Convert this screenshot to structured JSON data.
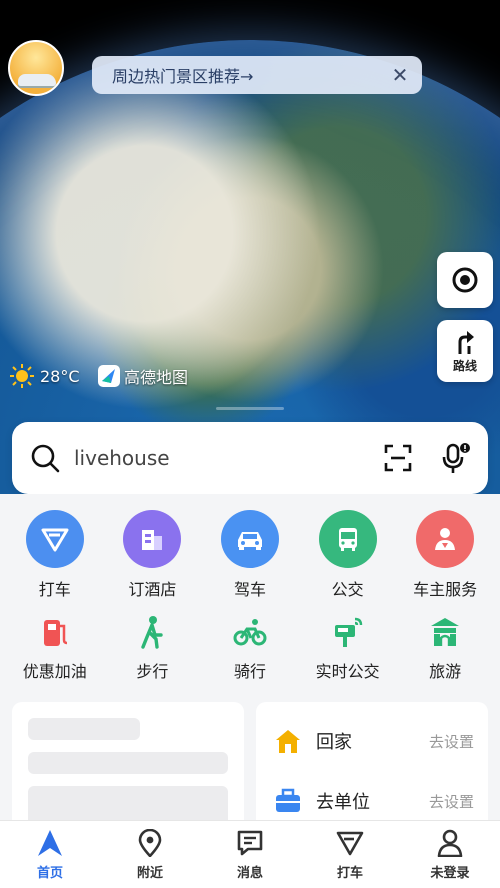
{
  "banner": {
    "text": "周边热门景区推荐→"
  },
  "map": {
    "route_label": "路线",
    "weather": "28°C",
    "brand": "高德地图"
  },
  "search": {
    "value": "livehouse"
  },
  "primary_services": [
    {
      "label": "打车",
      "color": "#4c8ff0",
      "icon": "taxi-icon"
    },
    {
      "label": "订酒店",
      "color": "#8a72ee",
      "icon": "hotel-icon"
    },
    {
      "label": "驾车",
      "color": "#4a92f2",
      "icon": "car-icon"
    },
    {
      "label": "公交",
      "color": "#36b87e",
      "icon": "bus-icon"
    },
    {
      "label": "车主服务",
      "color": "#f06a6a",
      "icon": "car-owner-icon"
    }
  ],
  "secondary_services": [
    {
      "label": "优惠加油",
      "color": "#f05454",
      "icon": "fuel-icon"
    },
    {
      "label": "步行",
      "color": "#2cb676",
      "icon": "walk-icon"
    },
    {
      "label": "骑行",
      "color": "#2cb676",
      "icon": "bike-icon"
    },
    {
      "label": "实时公交",
      "color": "#2cb676",
      "icon": "realtime-bus-icon"
    },
    {
      "label": "旅游",
      "color": "#2cb676",
      "icon": "travel-icon"
    }
  ],
  "places": [
    {
      "label": "回家",
      "action": "去设置",
      "icon": "home-icon",
      "color": "#f4b000"
    },
    {
      "label": "去单位",
      "action": "去设置",
      "icon": "briefcase-icon",
      "color": "#3a86f0"
    }
  ],
  "tabs": [
    {
      "label": "首页",
      "active": true,
      "icon": "home-nav-icon"
    },
    {
      "label": "附近",
      "active": false,
      "icon": "pin-icon"
    },
    {
      "label": "消息",
      "active": false,
      "icon": "message-icon"
    },
    {
      "label": "打车",
      "active": false,
      "icon": "taxi-nav-icon"
    },
    {
      "label": "未登录",
      "active": false,
      "icon": "user-icon"
    }
  ],
  "colors": {
    "accent": "#2e6fe6"
  }
}
